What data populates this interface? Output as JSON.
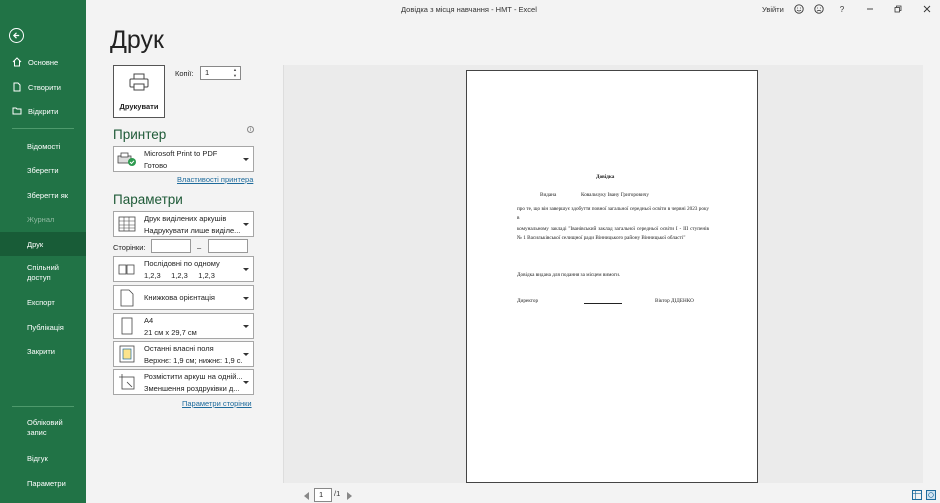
{
  "window": {
    "title": "Довідка з місця навчання - НМТ  -  Excel",
    "signin": "Увійти",
    "help": "?"
  },
  "sidebar": {
    "items": [
      {
        "label": "Основне",
        "icon": "home-icon"
      },
      {
        "label": "Створити",
        "icon": "new-file-icon"
      },
      {
        "label": "Відкрити",
        "icon": "open-folder-icon"
      },
      {
        "label": "Відомості"
      },
      {
        "label": "Зберегти"
      },
      {
        "label": "Зберегти як"
      },
      {
        "label": "Журнал"
      },
      {
        "label": "Друк"
      },
      {
        "label": "Спільний доступ"
      },
      {
        "label": "Експорт"
      },
      {
        "label": "Публікація"
      },
      {
        "label": "Закрити"
      }
    ],
    "bottom": [
      {
        "label": "Обліковий запис"
      },
      {
        "label": "Відгук"
      },
      {
        "label": "Параметри"
      }
    ]
  },
  "print": {
    "heading": "Друк",
    "button_label": "Друкувати",
    "copies_label": "Копії:",
    "copies_value": "1",
    "printer_heading": "Принтер",
    "printer_name": "Microsoft Print to PDF",
    "printer_status": "Готово",
    "printer_props_link": "Властивості принтера",
    "params_heading": "Параметри",
    "pages_label": "Сторінки:",
    "pages_dash": "–",
    "page_setup_link": "Параметри сторінки",
    "settings": [
      {
        "line1": "Друк виділених аркушів",
        "line2": "Надрукувати лише виділе..."
      },
      {
        "line1": "Послідовні по одному",
        "line2": "1,2,3     1,2,3     1,2,3"
      },
      {
        "line1": "Книжкова орієнтація",
        "line2": ""
      },
      {
        "line1": "A4",
        "line2": "21 см x 29,7 см"
      },
      {
        "line1": "Останні власні поля",
        "line2": "Верхнє: 1,9 см; нижнє: 1,9 с..."
      },
      {
        "line1": "Розмістити аркуш на одній...",
        "line2": "Зменшення роздруківки д..."
      }
    ]
  },
  "document": {
    "title": "Довідка",
    "issued_label": "Видана",
    "name": "Ковальчуку Івану Григоровичу",
    "para1": "про те, що він завершує здобуття повної загальної середньої освіти в червні 2023 року в",
    "para2": "комунальному закладі \"Іванівський заклад загальної середньої освіти I - III ступенів № 1 Васильківської селищної ради Вінницького району Вінницької області\"",
    "para3": "Довідка видана для подання за місцем вимоги.",
    "director_label": "Директор",
    "director_name": "Віктор ДІДЕНКО"
  },
  "preview_nav": {
    "current_page": "1",
    "total_pages": "/1"
  }
}
